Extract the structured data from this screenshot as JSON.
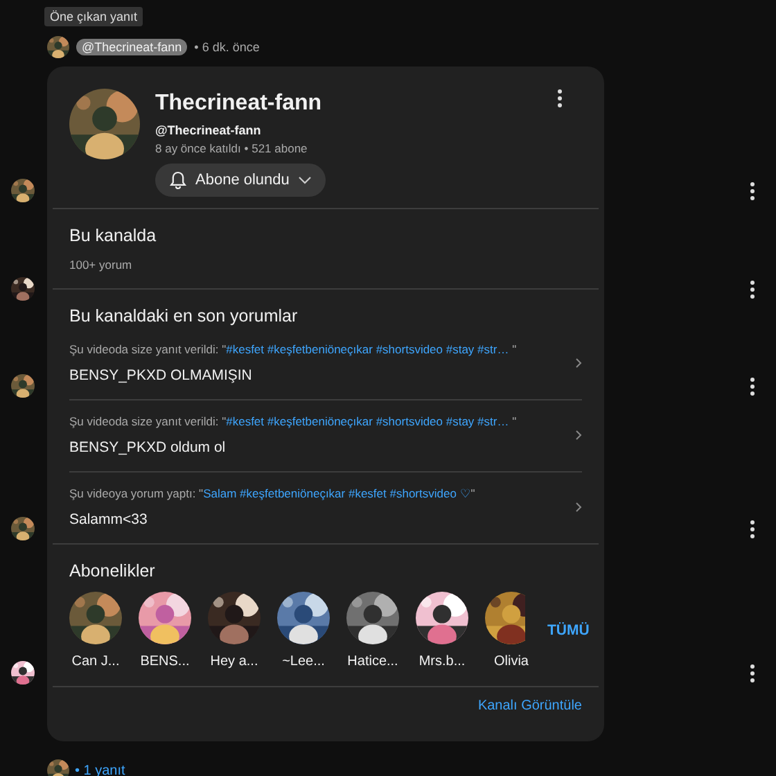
{
  "thread": {
    "badge": "Öne çıkan yanıt",
    "handle": "@Thecrineat-fann",
    "time": "• 6 dk. önce",
    "footer": "• 1 yanıt"
  },
  "channel_card": {
    "name": "Thecrineat-fann",
    "handle": "@Thecrineat-fann",
    "meta": "8 ay önce katıldı • 521 abone",
    "subscribe_button": "Abone olundu",
    "on_channel": {
      "title": "Bu kanalda",
      "count": "100+ yorum"
    },
    "recent": {
      "title": "Bu kanaldaki en son yorumlar",
      "items": [
        {
          "prefix": "Şu videoda size yanıt verildi: \"",
          "quote": "#kesfet #keşfetbeniöneçıkar #shortsvideo #stay #str…",
          "suffix": " \"",
          "text": "BENSY_PKXD OLMAMIŞIN"
        },
        {
          "prefix": "Şu videoda size yanıt verildi: \"",
          "quote": "#kesfet #keşfetbeniöneçıkar #shortsvideo #stay #str…",
          "suffix": " \"",
          "text": "BENSY_PKXD oldum ol"
        },
        {
          "prefix": "Şu videoya yorum yaptı: \"",
          "quote": "Salam #keşfetbeniöneçıkar #kesfet #shortsvideo ♡",
          "suffix": "\"",
          "text": "Salamm<33"
        }
      ]
    },
    "subscriptions": {
      "title": "Abonelikler",
      "all": "TÜMÜ",
      "channels": [
        {
          "name": "Can J..."
        },
        {
          "name": "BENS..."
        },
        {
          "name": "Hey a..."
        },
        {
          "name": "~Lee..."
        },
        {
          "name": "Hatice..."
        },
        {
          "name": "Mrs.b..."
        },
        {
          "name": "Olivia"
        }
      ]
    },
    "view_channel": "Kanalı Görüntüle"
  }
}
